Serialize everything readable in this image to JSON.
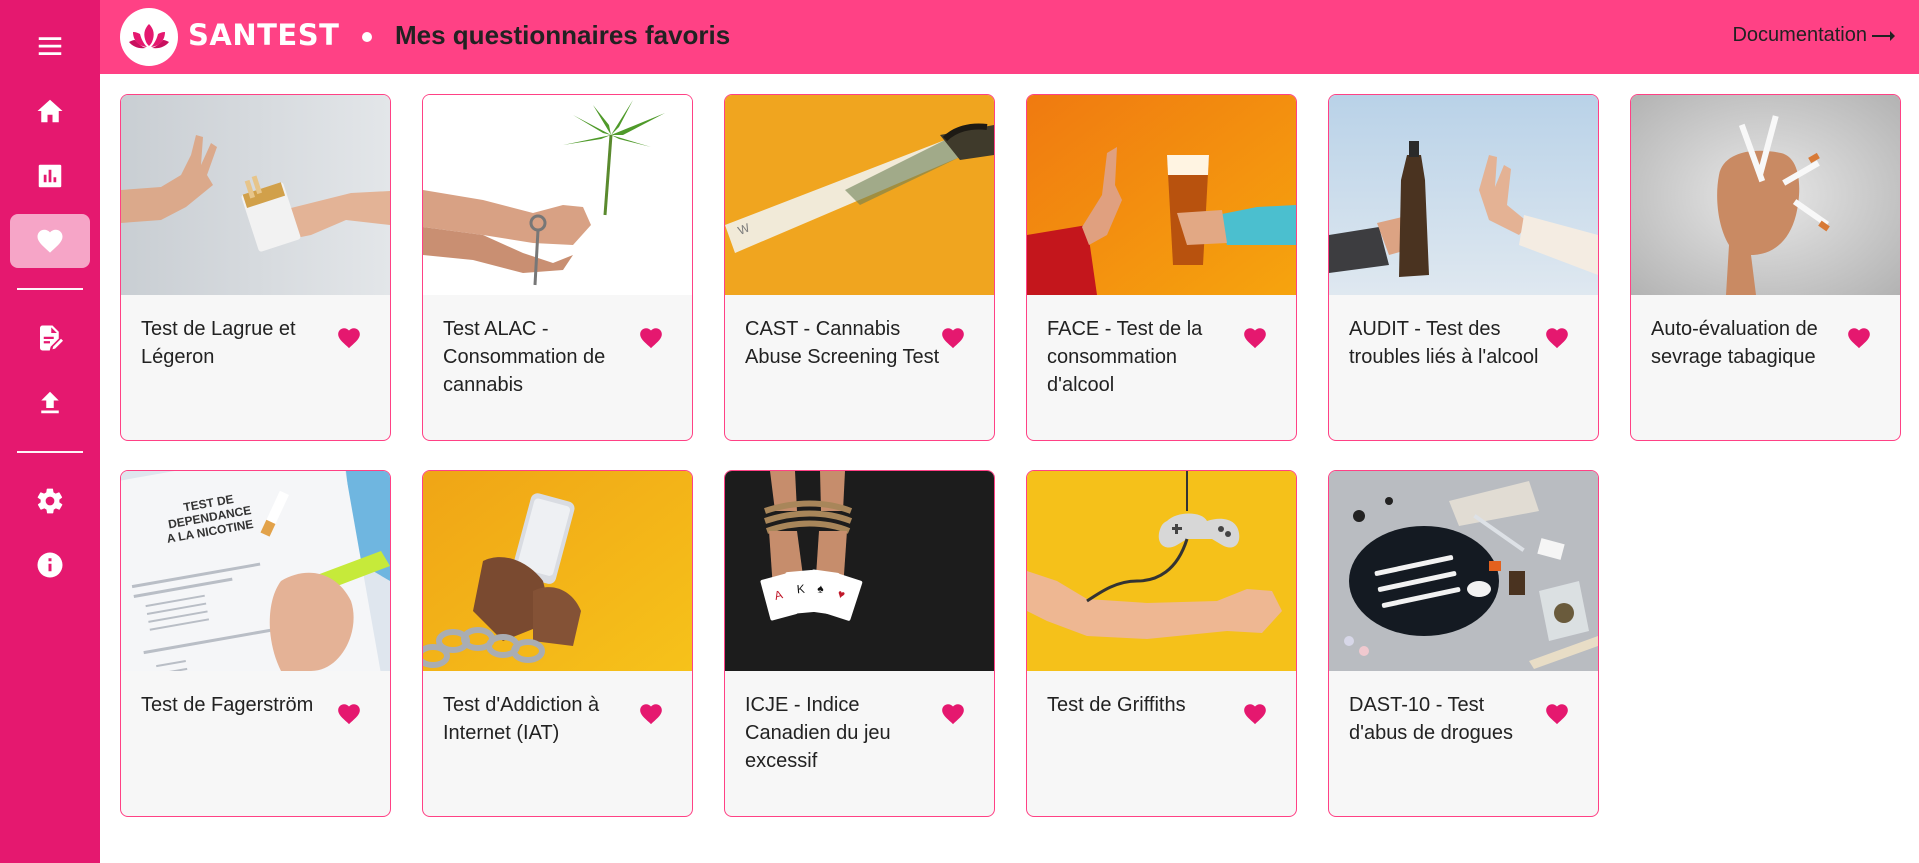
{
  "app": {
    "brand": "SANTEST",
    "page_title": "Mes questionnaires favoris",
    "documentation_label": "Documentation",
    "accent_color": "#e5186f",
    "header_color": "#ff4185"
  },
  "sidebar": {
    "items": [
      {
        "icon": "menu-icon"
      },
      {
        "icon": "home-icon"
      },
      {
        "icon": "chart-icon"
      },
      {
        "icon": "heart-icon",
        "active": true
      },
      {
        "icon": "edit-document-icon"
      },
      {
        "icon": "upload-icon"
      },
      {
        "icon": "gear-icon"
      },
      {
        "icon": "info-icon"
      }
    ]
  },
  "cards": [
    {
      "title": "Test de Lagrue et Légeron",
      "favorite": true
    },
    {
      "title": "Test ALAC - Consommation de cannabis",
      "favorite": true
    },
    {
      "title": "CAST - Cannabis Abuse Screening Test",
      "favorite": true
    },
    {
      "title": "FACE - Test de la consommation d'alcool",
      "favorite": true
    },
    {
      "title": "AUDIT - Test des troubles liés à l'alcool",
      "favorite": true
    },
    {
      "title": "Auto-évaluation de sevrage tabagique",
      "favorite": true
    },
    {
      "title": "Test de Fagerström",
      "favorite": true
    },
    {
      "title": "Test d'Addiction à Internet (IAT)",
      "favorite": true
    },
    {
      "title": "ICJE - Indice Canadien du jeu excessif",
      "favorite": true
    },
    {
      "title": "Test de Griffiths",
      "favorite": true
    },
    {
      "title": "DAST-10 - Test d'abus de drogues",
      "favorite": true
    }
  ],
  "nicotine_sheet": {
    "heading": "TEST DE DEPENDANCE A LA NICOTINE"
  }
}
